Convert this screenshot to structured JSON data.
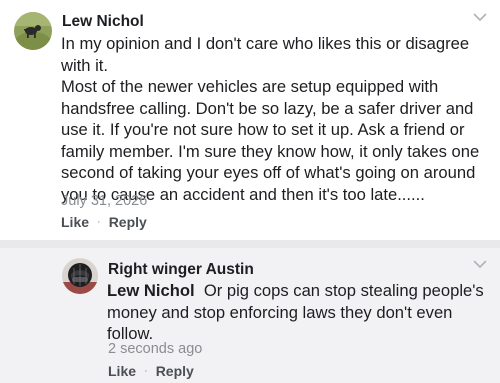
{
  "comments": [
    {
      "author": "Lew Nichol",
      "paragraphs": [
        "In my opinion and I don't care who likes this or disagree with it.",
        "Most of the newer vehicles are setup equipped with handsfree calling. Don't be so lazy, be a safer driver and use it. If you're not sure how to set it up. Ask a friend or family member. I'm sure they know how, it only takes one second of taking your eyes off of what's going on around you to cause an accident and then it's too late......"
      ],
      "timestamp": "July 31, 2026",
      "like_label": "Like",
      "reply_label": "Reply"
    }
  ],
  "reply": {
    "author": "Right winger Austin",
    "mention": "Lew Nichol",
    "text": "Or pig cops can stop stealing people's money and stop enforcing laws they don't even follow.",
    "timestamp": "2 seconds ago",
    "like_label": "Like",
    "reply_label": "Reply"
  },
  "separator": "·",
  "colors": {
    "text": "#1c1e21",
    "meta": "#8a8d91",
    "action": "#4b4f56",
    "reply_background": "#f2f2f4",
    "divider": "#e9e9eb"
  },
  "icons": {
    "avatar_1": "dog-on-grass-avatar",
    "avatar_2": "helmet-avatar",
    "menu": "chevron-down-icon"
  }
}
